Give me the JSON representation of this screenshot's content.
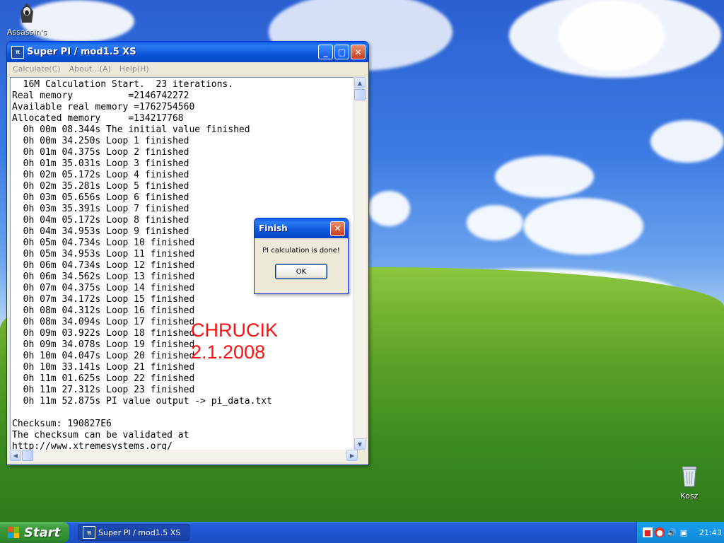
{
  "desktop": {
    "icons": [
      {
        "label": "Assassin's",
        "icon": "assassin-figure-icon"
      },
      {
        "label": "Kosz",
        "icon": "recycle-bin-icon"
      }
    ]
  },
  "window": {
    "title": "Super PI / mod1.5 XS",
    "menu": [
      "Calculate(C)",
      "About...(A)",
      "Help(H)"
    ],
    "console_lines": [
      "  16M Calculation Start.  23 iterations.",
      "Real memory          =2146742272",
      "Available real memory =1762754560",
      "Allocated memory     =134217768",
      "  0h 00m 08.344s The initial value finished",
      "  0h 00m 34.250s Loop 1 finished",
      "  0h 01m 04.375s Loop 2 finished",
      "  0h 01m 35.031s Loop 3 finished",
      "  0h 02m 05.172s Loop 4 finished",
      "  0h 02m 35.281s Loop 5 finished",
      "  0h 03m 05.656s Loop 6 finished",
      "  0h 03m 35.391s Loop 7 finished",
      "  0h 04m 05.172s Loop 8 finished",
      "  0h 04m 34.953s Loop 9 finished",
      "  0h 05m 04.734s Loop 10 finished",
      "  0h 05m 34.953s Loop 11 finished",
      "  0h 06m 04.734s Loop 12 finished",
      "  0h 06m 34.562s Loop 13 finished",
      "  0h 07m 04.375s Loop 14 finished",
      "  0h 07m 34.172s Loop 15 finished",
      "  0h 08m 04.312s Loop 16 finished",
      "  0h 08m 34.094s Loop 17 finished",
      "  0h 09m 03.922s Loop 18 finished",
      "  0h 09m 34.078s Loop 19 finished",
      "  0h 10m 04.047s Loop 20 finished",
      "  0h 10m 33.141s Loop 21 finished",
      "  0h 11m 01.625s Loop 22 finished",
      "  0h 11m 27.312s Loop 23 finished",
      "  0h 11m 52.875s PI value output -> pi_data.txt",
      "",
      "Checksum: 190827E6",
      "The checksum can be validated at",
      "http://www.xtremesystems.org/"
    ]
  },
  "watermark": {
    "line1": "CHRUCIK",
    "line2": "2.1.2008"
  },
  "dialog": {
    "title": "Finish",
    "message": "PI calculation is done!",
    "ok_label": "OK"
  },
  "taskbar": {
    "start_label": "Start",
    "task_label": "Super PI / mod1.5 XS",
    "clock": "21:43"
  },
  "colors": {
    "watermark": "#ff1010",
    "titlebar": "#0a5ce8",
    "start": "#3c9a3c"
  }
}
